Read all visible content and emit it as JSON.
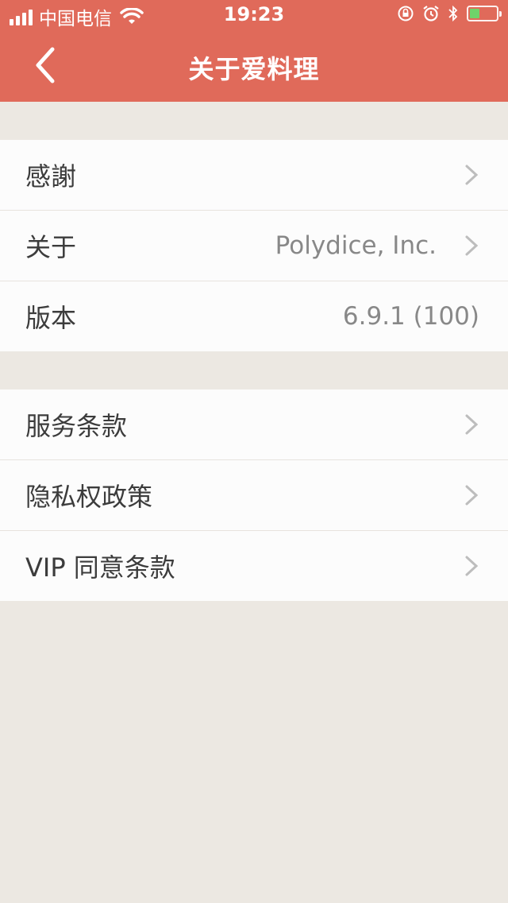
{
  "status_bar": {
    "carrier": "中国电信",
    "time": "19:23"
  },
  "nav": {
    "title": "关于爱料理"
  },
  "group1": [
    {
      "label": "感謝",
      "value": "",
      "chevron": true
    },
    {
      "label": "关于",
      "value": "Polydice, Inc.",
      "chevron": true
    },
    {
      "label": "版本",
      "value": "6.9.1 (100)",
      "chevron": false
    }
  ],
  "group2": [
    {
      "label": "服务条款",
      "chevron": true
    },
    {
      "label": "隐私权政策",
      "chevron": true
    },
    {
      "label": "VIP 同意条款",
      "chevron": true
    }
  ],
  "colors": {
    "header": "#e06a5a",
    "background": "#ece8e2",
    "cell": "#fcfcfc"
  }
}
